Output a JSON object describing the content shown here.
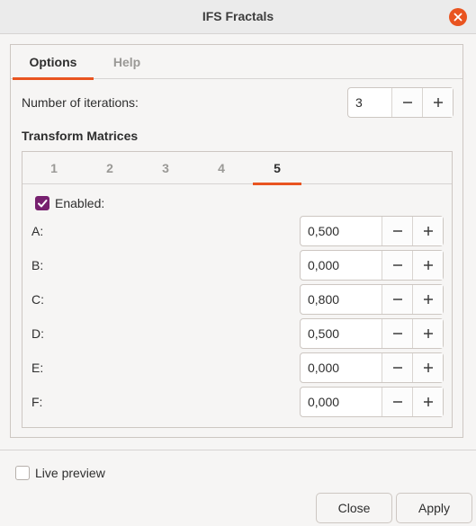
{
  "window": {
    "title": "IFS Fractals"
  },
  "tabs": [
    {
      "label": "Options"
    },
    {
      "label": "Help"
    }
  ],
  "options": {
    "iterations_label": "Number of iterations:",
    "iterations_value": "3",
    "transform_title": "Transform Matrices",
    "matrix_tabs": [
      "1",
      "2",
      "3",
      "4",
      "5"
    ],
    "active_matrix_tab": "5",
    "enabled_label": "Enabled:",
    "enabled_checked": true,
    "rows": [
      {
        "label": "A:",
        "value": "0,500"
      },
      {
        "label": "B:",
        "value": "0,000"
      },
      {
        "label": "C:",
        "value": "0,800"
      },
      {
        "label": "D:",
        "value": "0,500"
      },
      {
        "label": "E:",
        "value": "0,000"
      },
      {
        "label": "F:",
        "value": "0,000"
      }
    ]
  },
  "footer": {
    "live_preview_label": "Live preview",
    "live_preview_checked": false,
    "close_label": "Close",
    "apply_label": "Apply"
  },
  "colors": {
    "accent": "#e95420",
    "checkbox": "#77216f"
  }
}
